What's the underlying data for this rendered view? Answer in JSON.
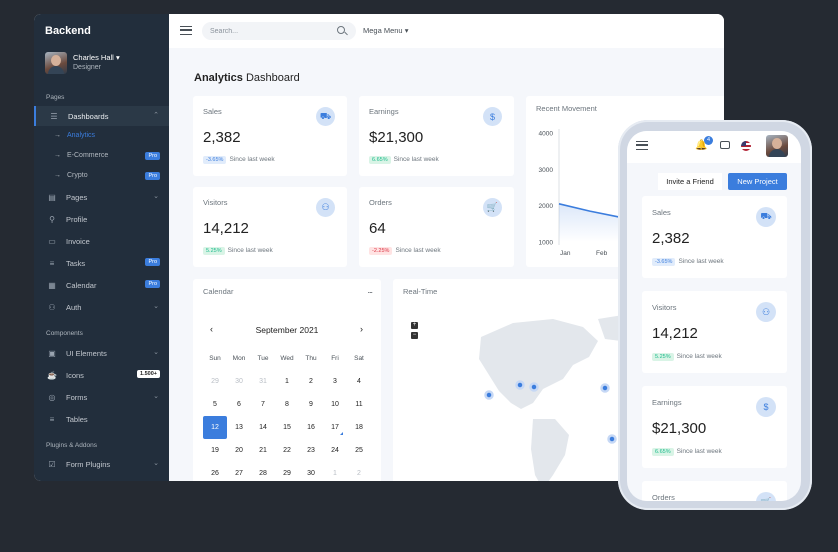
{
  "brand": "Backend",
  "user": {
    "name": "Charles Hall",
    "role": "Designer"
  },
  "sidebar": {
    "sections": [
      "Pages",
      "Components",
      "Plugins & Addons"
    ],
    "items": [
      {
        "label": "Dashboards",
        "icon": "sliders-icon"
      },
      {
        "label": "Pages",
        "icon": "layout-icon"
      },
      {
        "label": "Profile",
        "icon": "user-icon"
      },
      {
        "label": "Invoice",
        "icon": "credit-card-icon"
      },
      {
        "label": "Tasks",
        "icon": "list-icon",
        "badge": "Pro"
      },
      {
        "label": "Calendar",
        "icon": "calendar-icon",
        "badge": "Pro"
      },
      {
        "label": "Auth",
        "icon": "users-icon"
      },
      {
        "label": "UI Elements",
        "icon": "briefcase-icon"
      },
      {
        "label": "Icons",
        "icon": "coffee-icon",
        "badge": "1.500+"
      },
      {
        "label": "Forms",
        "icon": "check-circle-icon"
      },
      {
        "label": "Tables",
        "icon": "list-icon"
      },
      {
        "label": "Form Plugins",
        "icon": "check-square-icon"
      }
    ],
    "subitems": [
      {
        "label": "Analytics"
      },
      {
        "label": "E-Commerce",
        "badge": "Pro"
      },
      {
        "label": "Crypto",
        "badge": "Pro"
      }
    ]
  },
  "topbar": {
    "search_placeholder": "Search...",
    "mega_menu": "Mega Menu"
  },
  "page_title": {
    "bold": "Analytics",
    "rest": " Dashboard"
  },
  "stats": [
    {
      "label": "Sales",
      "value": "2,382",
      "change": "-3.65%",
      "since": "Since last week",
      "icon": "truck-icon"
    },
    {
      "label": "Earnings",
      "value": "$21,300",
      "change": "6.65%",
      "since": "Since last week",
      "icon": "dollar-icon"
    },
    {
      "label": "Visitors",
      "value": "14,212",
      "change": "5.25%",
      "since": "Since last week",
      "icon": "users-icon"
    },
    {
      "label": "Orders",
      "value": "64",
      "change": "-2.25%",
      "since": "Since last week",
      "icon": "cart-icon"
    }
  ],
  "recent_movement": {
    "title": "Recent Movement"
  },
  "chart_data": {
    "type": "area",
    "title": "Recent Movement",
    "categories": [
      "Jan",
      "Feb"
    ],
    "x": [
      0,
      0.35,
      0.7,
      1.0,
      1.3,
      1.6,
      1.9
    ],
    "values": [
      2050,
      1850,
      1680,
      1560,
      1500,
      1490,
      1490
    ],
    "yticks": [
      1000,
      2000,
      3000,
      4000
    ],
    "ylim": [
      1000,
      4000
    ],
    "grid": false
  },
  "calendar": {
    "title": "Calendar",
    "menu": "...",
    "month": "September  2021",
    "prev": "‹",
    "next": "›",
    "weekdays": [
      "Sun",
      "Mon",
      "Tue",
      "Wed",
      "Thu",
      "Fri",
      "Sat"
    ],
    "days": [
      [
        "29",
        "30",
        "31",
        "1",
        "2",
        "3",
        "4"
      ],
      [
        "5",
        "6",
        "7",
        "8",
        "9",
        "10",
        "11"
      ],
      [
        "12",
        "13",
        "14",
        "15",
        "16",
        "17",
        "18"
      ],
      [
        "19",
        "20",
        "21",
        "22",
        "23",
        "24",
        "25"
      ],
      [
        "26",
        "27",
        "28",
        "29",
        "30",
        "1",
        "2"
      ]
    ]
  },
  "realtime": {
    "title": "Real-Time",
    "zoom_in": "+",
    "zoom_out": "−"
  },
  "phone": {
    "bell_count": "4",
    "invite_label": "Invite a Friend",
    "new_project_label": "New Project",
    "stats": [
      {
        "label": "Sales",
        "value": "2,382",
        "change": "-3.65%",
        "since": "Since last week"
      },
      {
        "label": "Visitors",
        "value": "14,212",
        "change": "5.25%",
        "since": "Since last week"
      },
      {
        "label": "Earnings",
        "value": "$21,300",
        "change": "6.65%",
        "since": "Since last week"
      },
      {
        "label": "Orders"
      }
    ]
  },
  "colors": {
    "primary": "#3b7ddd",
    "sidebar": "#222e3c",
    "background": "#f5f7fb",
    "danger": "#dc3545",
    "success": "#1cbb8c"
  }
}
